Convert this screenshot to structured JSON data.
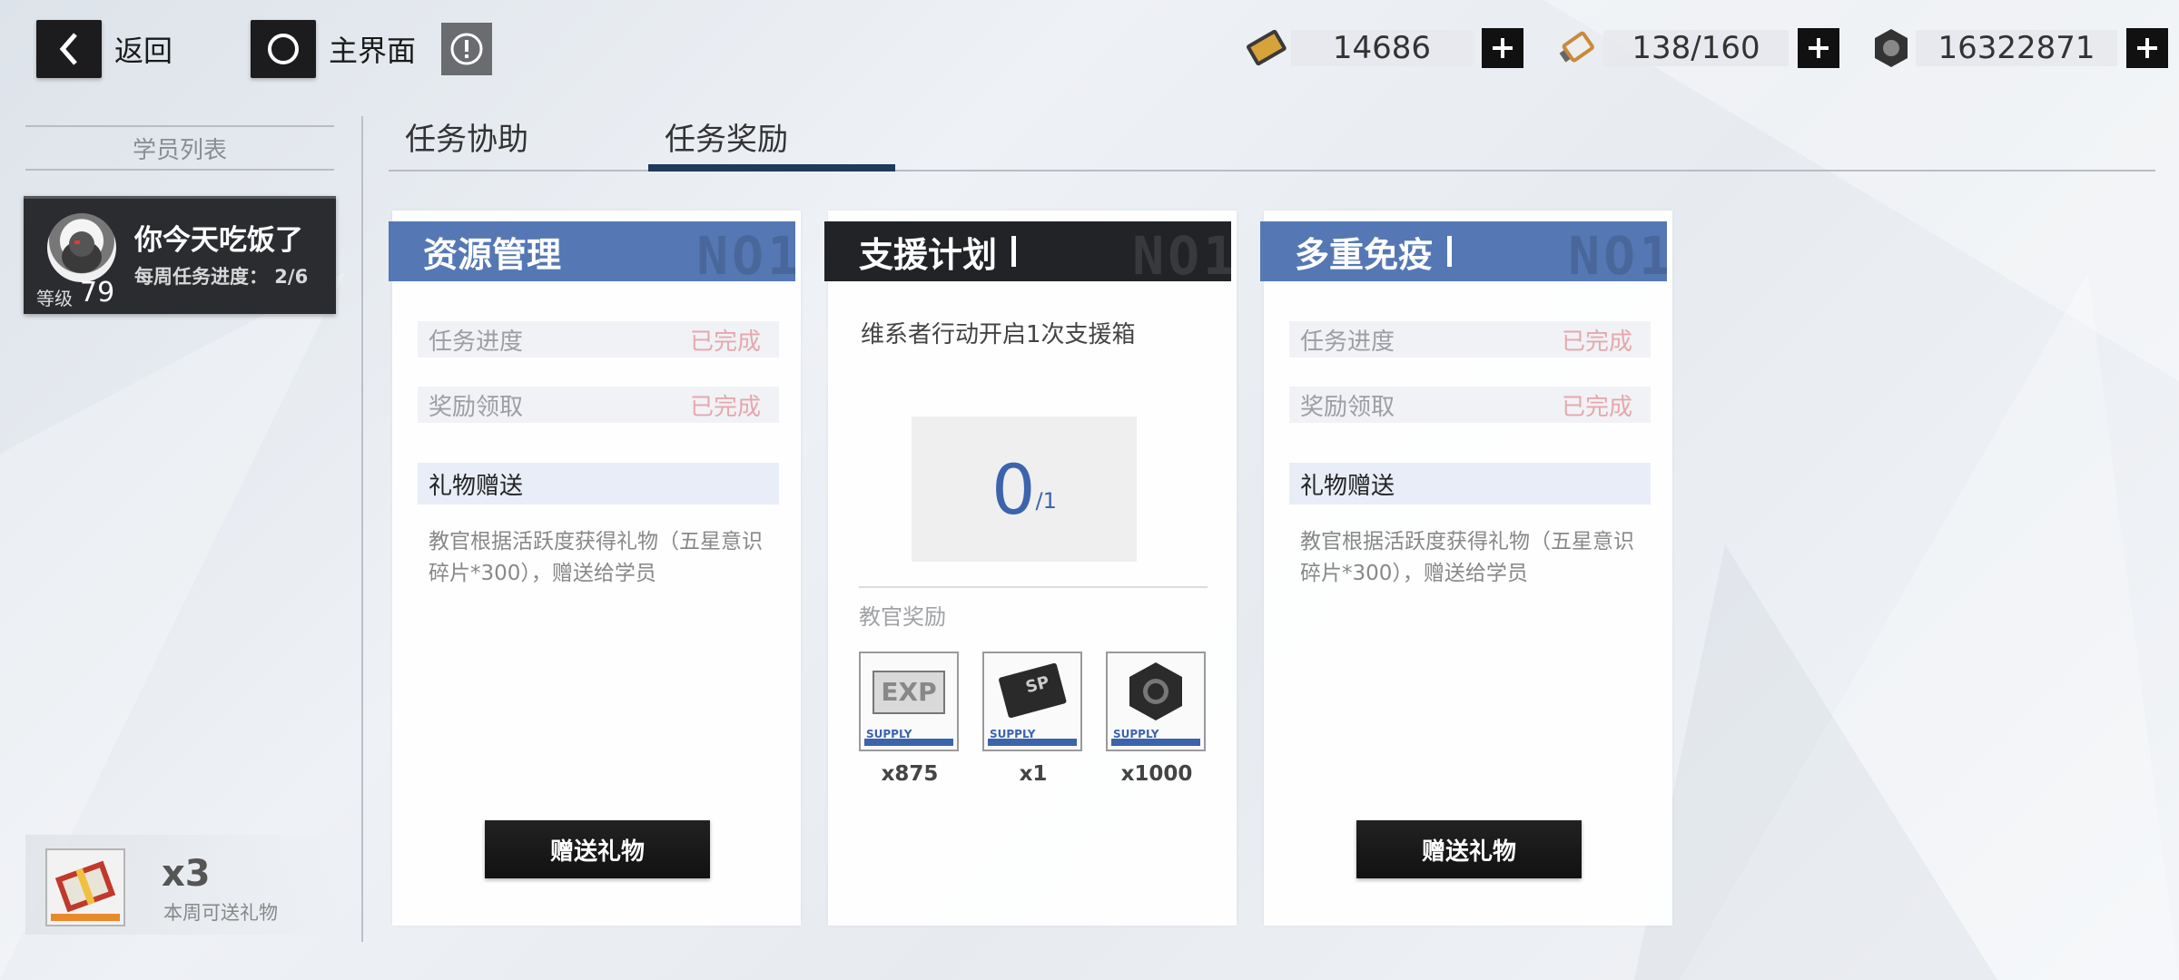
{
  "topbar": {
    "back_label": "返回",
    "home_label": "主界面",
    "resources": [
      {
        "icon": "ticket-icon",
        "value": "14686"
      },
      {
        "icon": "battery-icon",
        "value": "138/160"
      },
      {
        "icon": "nut-icon",
        "value": "16322871"
      }
    ]
  },
  "sidebar": {
    "header": "学员列表",
    "student": {
      "name": "你今天吃饭了",
      "progress": "每周任务进度： 2/6",
      "level_label": "等级",
      "level": "79"
    },
    "gift": {
      "count": "x3",
      "label": "本周可送礼物"
    }
  },
  "tabs": [
    {
      "label": "任务协助",
      "active": false
    },
    {
      "label": "任务奖励",
      "active": true
    }
  ],
  "cards": [
    {
      "title": "资源管理",
      "header_style": "blue",
      "watermark": "NO1",
      "rows": [
        {
          "key": "任务进度",
          "value": "已完成"
        },
        {
          "key": "奖励领取",
          "value": "已完成"
        }
      ],
      "gift_title": "礼物赠送",
      "description": "教官根据活跃度获得礼物（五星意识碎片*300），赠送给学员",
      "button": "赠送礼物"
    },
    {
      "title": "支援计划",
      "header_style": "dark",
      "watermark": "NO1",
      "mission": "维系者行动开启1次支援箱",
      "progress_current": "0",
      "progress_total": "/1",
      "reward_label": "教官奖励",
      "rewards": [
        {
          "icon": "exp-chip-icon",
          "qty": "x875"
        },
        {
          "icon": "sp-card-icon",
          "qty": "x1"
        },
        {
          "icon": "nut-icon",
          "qty": "x1000"
        }
      ],
      "supply_text": "SUPPLY"
    },
    {
      "title": "多重免疫",
      "header_style": "blue",
      "watermark": "NO1",
      "rows": [
        {
          "key": "任务进度",
          "value": "已完成"
        },
        {
          "key": "奖励领取",
          "value": "已完成"
        }
      ],
      "gift_title": "礼物赠送",
      "description": "教官根据活跃度获得礼物（五星意识碎片*300），赠送给学员",
      "button": "赠送礼物"
    }
  ],
  "colors": {
    "accent_blue": "#5578b4",
    "dark_header": "#222326",
    "completed_text": "#e4a8ae",
    "counter_blue": "#3b64ad"
  }
}
